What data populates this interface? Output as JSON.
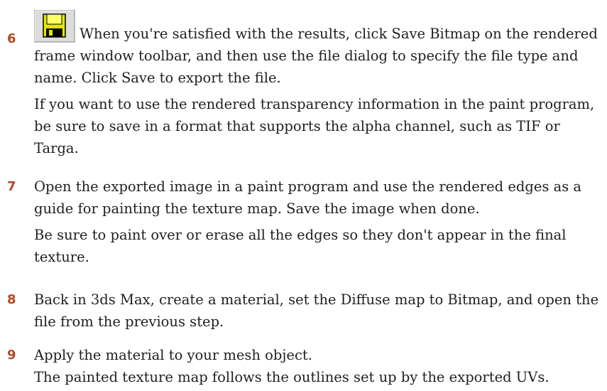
{
  "steps": [
    {
      "number": "6",
      "icon": "save-bitmap-icon",
      "paragraphs": [
        "When you're satisfied with the results, click Save Bitmap on the rendered frame window toolbar, and then use the file dialog to specify the file type and name. Click Save to export the file.",
        "If you want to use the rendered transparency information in the paint program, be sure to save in a format that supports the alpha channel, such as TIF or Targa."
      ]
    },
    {
      "number": "7",
      "paragraphs": [
        "Open the exported image in a paint program and use the rendered edges as a guide for painting the texture map. Save the image when done.",
        "Be sure to paint over or erase all the edges so they don't appear in the final texture."
      ]
    },
    {
      "number": "8",
      "paragraphs": [
        "Back in 3ds Max, create a material, set the Diffuse map to Bitmap, and open the file from the previous step."
      ]
    },
    {
      "number": "9",
      "paragraphs": [
        "Apply the material to your mesh object.",
        "The painted texture map follows the outlines set up by the exported UVs."
      ]
    }
  ],
  "colors": {
    "step_number": "#b34722",
    "text": "#1f1f1f"
  }
}
